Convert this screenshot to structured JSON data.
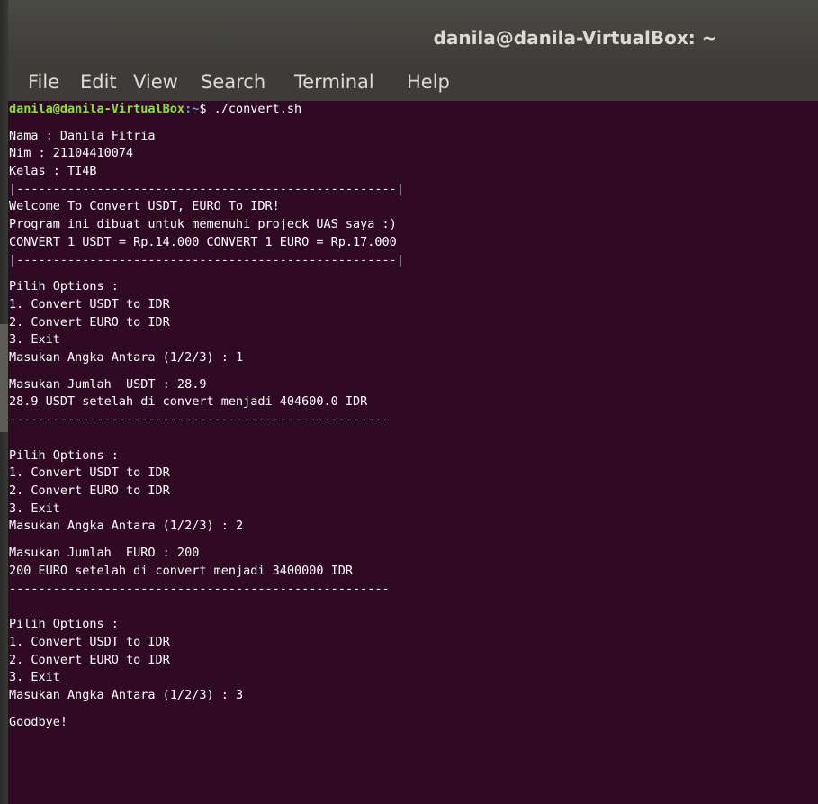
{
  "window": {
    "title": "danila@danila-VirtualBox: ~"
  },
  "menu": {
    "items": [
      "File",
      "Edit",
      "View",
      "Search",
      "Terminal",
      "Help"
    ]
  },
  "colors": {
    "terminal_bg": "#300a24",
    "prompt_user": "#8ae234",
    "prompt_path": "#729fcf",
    "text": "#ffffff"
  },
  "terminal": {
    "prompt_user": "danila@danila-VirtualBox",
    "prompt_sep": ":",
    "prompt_path": "~",
    "prompt_symbol": "$ ",
    "command": "./convert.sh",
    "output_block1": [
      "Nama : Danila Fitria",
      "Nim : 21104410074",
      "Kelas : TI4B",
      "|----------------------------------------------------|",
      "Welcome To Convert USDT, EURO To IDR!",
      "Program ini dibuat untuk memenuhi projeck UAS saya :)",
      "CONVERT 1 USDT = Rp.14.000 CONVERT 1 EURO = Rp.17.000",
      "|----------------------------------------------------|"
    ],
    "menu_block": {
      "header": "Pilih Options :",
      "opt1": "1. Convert USDT to IDR",
      "opt2": "2. Convert EURO to IDR",
      "opt3": "3. Exit"
    },
    "round1": {
      "choice": "Masukan Angka Antara (1/2/3) : 1",
      "amount": "Masukan Jumlah  USDT : 28.9",
      "result": "28.9 USDT setelah di convert menjadi 404600.0 IDR",
      "divider": "----------------------------------------------------"
    },
    "round2": {
      "choice": "Masukan Angka Antara (1/2/3) : 2",
      "amount": "Masukan Jumlah  EURO : 200",
      "result": "200 EURO setelah di convert menjadi 3400000 IDR",
      "divider": "----------------------------------------------------"
    },
    "round3": {
      "choice": "Masukan Angka Antara (1/2/3) : 3",
      "goodbye": "Goodbye!"
    }
  }
}
